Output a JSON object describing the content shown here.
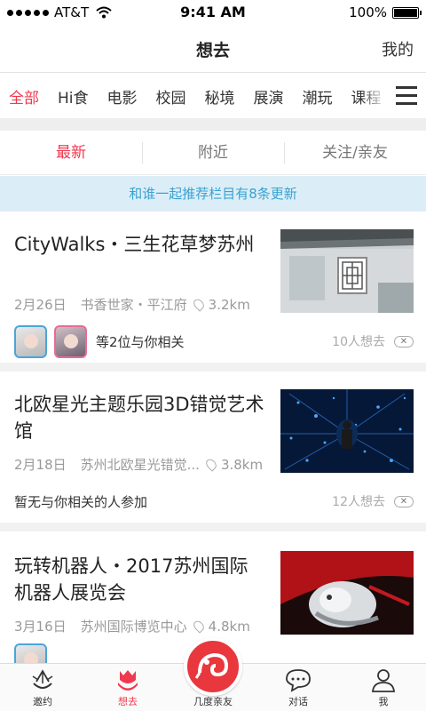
{
  "status_bar": {
    "carrier": "AT&T",
    "time": "9:41 AM",
    "battery": "100%"
  },
  "nav": {
    "title": "想去",
    "mine": "我的"
  },
  "categories": [
    {
      "label": "全部",
      "active": true
    },
    {
      "label": "Hi食"
    },
    {
      "label": "电影"
    },
    {
      "label": "校园"
    },
    {
      "label": "秘境"
    },
    {
      "label": "展演"
    },
    {
      "label": "潮玩"
    },
    {
      "label": "课程"
    }
  ],
  "sub_tabs": [
    {
      "label": "最新",
      "active": true
    },
    {
      "label": "附近"
    },
    {
      "label": "关注/亲友"
    }
  ],
  "notice": "和谁一起推荐栏目有8条更新",
  "cards": [
    {
      "title": "CityWalks・三生花草梦苏州",
      "date": "2月26日",
      "venue": "书香世家・平江府",
      "distance": "3.2km",
      "related_text": "等2位与你相关",
      "want_count": "10人想去"
    },
    {
      "title": "北欧星光主题乐园3D错觉艺术馆",
      "date": "2月18日",
      "venue": "苏州北欧星光错觉...",
      "distance": "3.8km",
      "related_text": "暂无与你相关的人参加",
      "want_count": "12人想去"
    },
    {
      "title": "玩转机器人・2017苏州国际机器人展览会",
      "date": "3月16日",
      "venue": "苏州国际博览中心",
      "distance": "4.8km"
    }
  ],
  "tabbar": [
    {
      "label": "邀约",
      "icon": "invite-icon"
    },
    {
      "label": "想去",
      "icon": "tulip-icon",
      "active": true
    },
    {
      "label": "几度亲友",
      "icon": "chameleon-icon"
    },
    {
      "label": "对话",
      "icon": "chat-bubble-icon"
    },
    {
      "label": "我",
      "icon": "person-icon"
    }
  ],
  "colors": {
    "accent": "#f0384f",
    "notice_bg": "#dbeef7",
    "notice_text": "#3aa1d2"
  }
}
